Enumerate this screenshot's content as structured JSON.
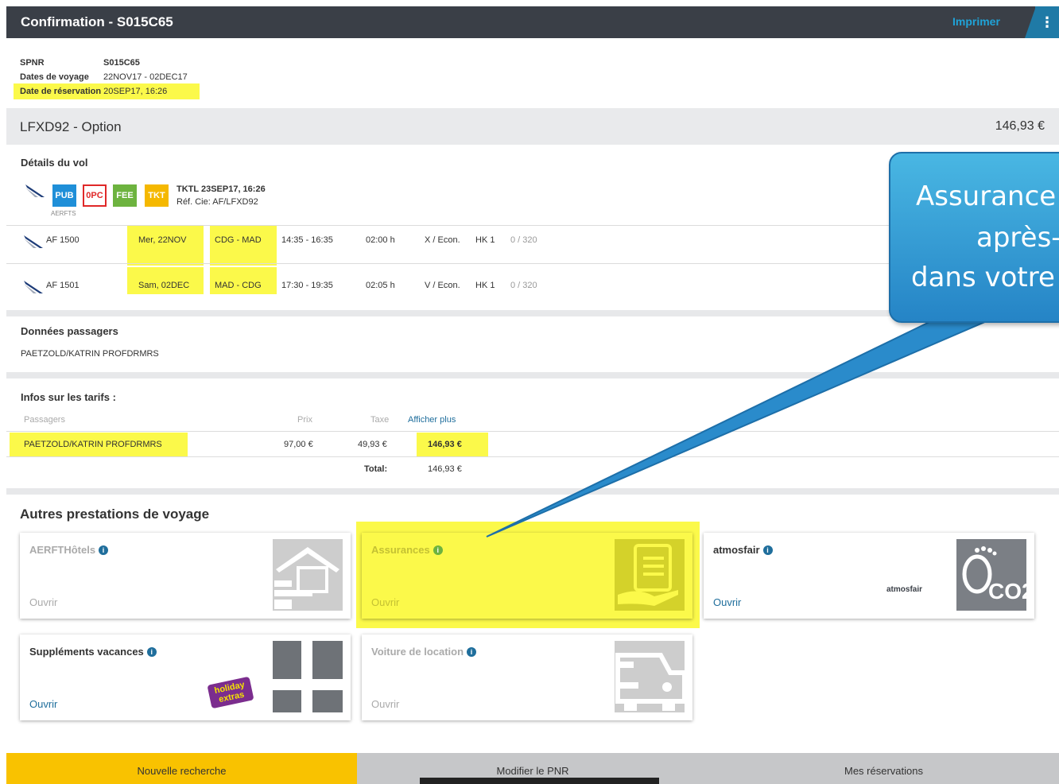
{
  "header": {
    "title": "Confirmation - S015C65",
    "print_label": "Imprimer",
    "menu_icon": "⋮"
  },
  "pnr_info": {
    "spnr_label": "SPNR",
    "spnr_value": "S015C65",
    "dates_label": "Dates de voyage",
    "dates_value": "22NOV17 - 02DEC17",
    "booking_label": "Date de réservation",
    "booking_value": "20SEP17, 16:26"
  },
  "option": {
    "title": "LFXD92 -  Option",
    "price": "146,93 €"
  },
  "flight_details": {
    "title": "Détails du vol",
    "badges": [
      "PUB",
      "0PC",
      "FEE",
      "TKT"
    ],
    "airline_code": "AERFTS",
    "tktl": "TKTL 23SEP17, 16:26",
    "ref": "Réf. Cie: AF/LFXD92",
    "flights": [
      {
        "number": "AF 1500",
        "date": "Mer,  22NOV",
        "route": "CDG  -  MAD",
        "time": "14:35  -  16:35",
        "duration": "02:00 h",
        "class": "X / Econ.",
        "status": "HK 1",
        "seats": "0 / 320"
      },
      {
        "number": "AF 1501",
        "date": "Sam,  02DEC",
        "route": "MAD  -  CDG",
        "time": "17:30  -  19:35",
        "duration": "02:05 h",
        "class": "V / Econ.",
        "status": "HK 1",
        "seats": "0 / 320"
      }
    ]
  },
  "passengers": {
    "title": "Données passagers",
    "name": "PAETZOLD/KATRIN  PROFDRMRS"
  },
  "fares": {
    "title": "Infos sur les tarifs :",
    "col_passengers": "Passagers",
    "col_price": "Prix",
    "col_tax": "Taxe",
    "show_more": "Afficher plus",
    "row": {
      "name": "PAETZOLD/KATRIN  PROFDRMRS",
      "price": "97,00 €",
      "tax": "49,93 €",
      "total": "146,93 €"
    },
    "total_label": "Total:",
    "total_value": "146,93 €"
  },
  "services": {
    "title": "Autres prestations de voyage",
    "cards": [
      {
        "title": "AERFTHôtels",
        "open": "Ouvrir",
        "icon": "hotel-bed-icon"
      },
      {
        "title": "Assurances",
        "open": "Ouvrir",
        "icon": "insurance-document-icon"
      },
      {
        "title": "atmosfair",
        "open": "Ouvrir",
        "icon": "co2-footprint-icon",
        "logo": "atmosfair",
        "co2": "CO2"
      },
      {
        "title": "Suppléments vacances",
        "open": "Ouvrir",
        "icon": "plus-icon",
        "logo_line1": "holiday",
        "logo_line2": "extras"
      },
      {
        "title": "Voiture de location",
        "open": "Ouvrir",
        "icon": "car-icon"
      }
    ]
  },
  "bottom_bar": {
    "new_search": "Nouvelle recherche",
    "modify_pnr": "Modifier le PNR",
    "my_bookings": "Mes réservations"
  },
  "callout": {
    "line1": "Assurance",
    "line2": "après-",
    "line3": "dans votre"
  },
  "colors": {
    "highlight": "#fbf94a",
    "header": "#3a3f47",
    "accent": "#1f6e9c",
    "bottom_yellow": "#f9c200"
  }
}
